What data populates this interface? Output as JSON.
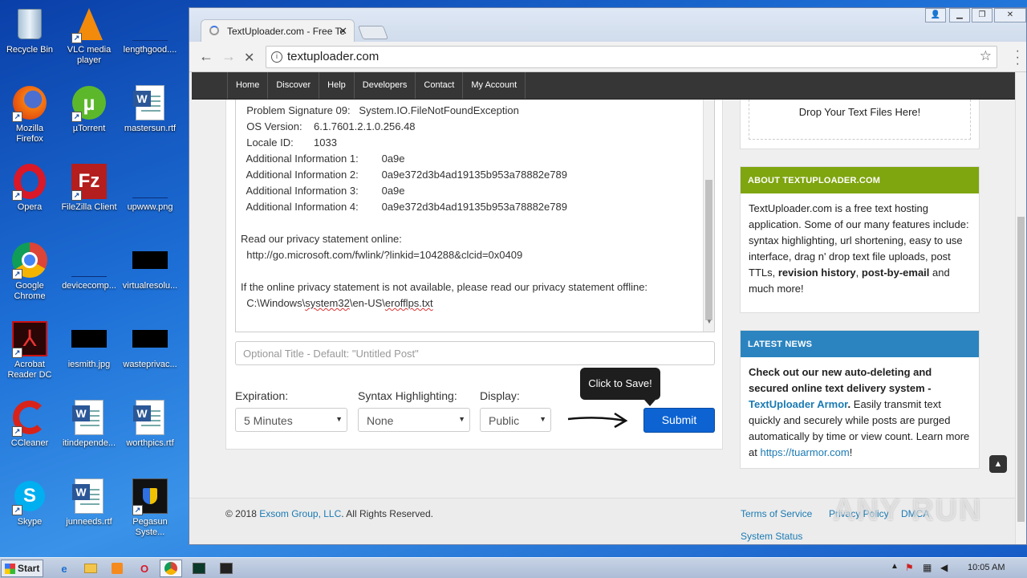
{
  "desktop": {
    "icons": [
      {
        "label": "Recycle Bin"
      },
      {
        "label": "VLC media player"
      },
      {
        "label": "lengthgood...."
      },
      {
        "label": "Mozilla Firefox"
      },
      {
        "label": "µTorrent"
      },
      {
        "label": "mastersun.rtf"
      },
      {
        "label": "Opera"
      },
      {
        "label": "FileZilla Client"
      },
      {
        "label": "upwww.png"
      },
      {
        "label": "Google Chrome"
      },
      {
        "label": "devicecomp..."
      },
      {
        "label": "virtualresolu..."
      },
      {
        "label": "Acrobat Reader DC"
      },
      {
        "label": "iesmith.jpg"
      },
      {
        "label": "wasteprivac..."
      },
      {
        "label": "CCleaner"
      },
      {
        "label": "itindepende..."
      },
      {
        "label": "worthpics.rtf"
      },
      {
        "label": "Skype"
      },
      {
        "label": "junneeds.rtf"
      },
      {
        "label": "Pegasun Syste..."
      }
    ]
  },
  "browser": {
    "tab_title": "TextUploader.com - Free Te",
    "address": "textuploader.com"
  },
  "site": {
    "nav": [
      "Home",
      "Discover",
      "Help",
      "Developers",
      "Contact",
      "My Account"
    ],
    "paste_lines": [
      "  Problem Signature 09:   System.IO.FileNotFoundException",
      "  OS Version:    6.1.7601.2.1.0.256.48",
      "  Locale ID:       1033",
      "  Additional Information 1:        0a9e",
      "  Additional Information 2:        0a9e372d3b4ad19135b953a78882e789",
      "  Additional Information 3:        0a9e",
      "  Additional Information 4:        0a9e372d3b4ad19135b953a78882e789",
      "",
      "Read our privacy statement online:",
      "  http://go.microsoft.com/fwlink/?linkid=104288&clcid=0x0409",
      "",
      "If the online privacy statement is not available, please read our privacy statement offline:"
    ],
    "offline_path_a": "  C:\\Windows\\",
    "offline_path_b": "system32",
    "offline_path_c": "\\en-US\\",
    "offline_path_d": "erofflps.txt",
    "title_placeholder": "Optional Title - Default: \"Untitled Post\"",
    "expiration_label": "Expiration:",
    "expiration_value": "5 Minutes",
    "syntax_label": "Syntax Highlighting:",
    "syntax_value": "None",
    "display_label": "Display:",
    "display_value": "Public",
    "tooltip": "Click to Save!",
    "submit": "Submit",
    "dropzone": "Drop Your Text Files Here!",
    "about_heading": "ABOUT TEXTUPLOADER.COM",
    "about_text_1": "TextUploader.com is a free text hosting application. Some of our many features include: syntax highlighting, url shortening, easy to use interface, drag n' drop text file uploads, post TTLs, ",
    "about_bold_1": "revision history",
    "about_text_2": ", ",
    "about_bold_2": "post-by-email",
    "about_text_3": " and much more!",
    "news_heading": "LATEST NEWS",
    "news_bold": "Check out our new auto-deleting and secured online text delivery system - ",
    "news_link": "TextUploader Armor",
    "news_text": " Easily transmit text quickly and securely while posts are purged automatically by time or view count. Learn more at ",
    "news_url": "https://tuarmor.com",
    "news_end": "!",
    "footer_copy": "© 2018 ",
    "footer_company": "Exsom Group, LLC",
    "footer_rights": ". All Rights Reserved.",
    "footer_links": [
      "Terms of Service",
      "Privacy Policy",
      "DMCA",
      "System Status"
    ]
  },
  "taskbar": {
    "start": "Start",
    "clock": "10:05 AM"
  },
  "watermark": "ANY RUN",
  "colors": {
    "about_header": "#7fa50f",
    "news_header": "#2b84c0",
    "submit": "#0d63d2",
    "nav_bg": "#363636"
  }
}
